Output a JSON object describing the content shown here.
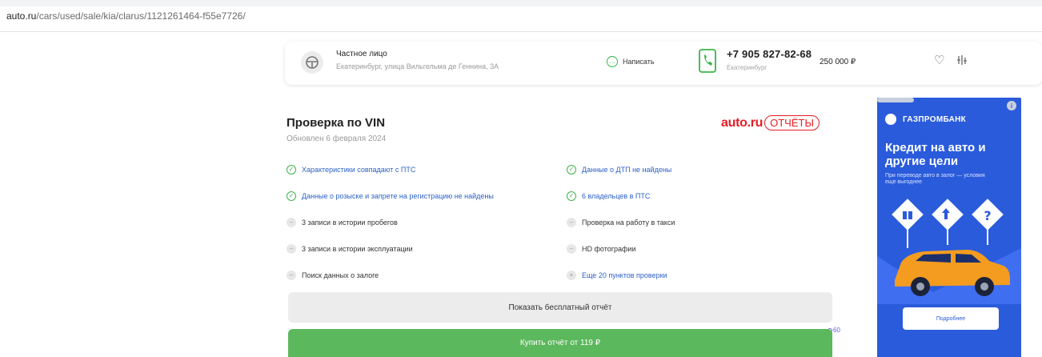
{
  "browser": {
    "url_domain": "auto.ru",
    "url_path": "/cars/used/sale/kia/clarus/1121261464-f55e7726/"
  },
  "seller": {
    "name": "Частное лицо",
    "address": "Екатеринбург, улица Вильгельма де Геннина, 3А",
    "write_label": "Написать",
    "phone": "+7 905 827-82-68",
    "phone_note": "Екатеринбург",
    "price": "250 000 ₽"
  },
  "vin_check": {
    "title": "Проверка по VIN",
    "updated": "Обновлен 6 февраля 2024",
    "brand_text": "auto.ru",
    "brand_pill": "ОТЧЁТЫ",
    "items_left": [
      {
        "text": "Характеристики совпадают с ПТС",
        "status": "ok"
      },
      {
        "text": "Данные о розыске и запрете на регистрацию не найдены",
        "status": "ok"
      },
      {
        "text": "3 записи в истории пробегов",
        "status": "neutral"
      },
      {
        "text": "3 записи в истории эксплуатации",
        "status": "neutral"
      },
      {
        "text": "Поиск данных о залоге",
        "status": "neutral"
      }
    ],
    "items_right": [
      {
        "text": "Данные о ДТП не найдены",
        "status": "ok"
      },
      {
        "text": "6 владельцев в ПТС",
        "status": "ok"
      },
      {
        "text": "Проверка на работу в такси",
        "status": "neutral"
      },
      {
        "text": "HD фотографии",
        "status": "neutral"
      },
      {
        "text": "Еще 20 пунктов проверки",
        "status": "link"
      }
    ],
    "free_button": "Показать бесплатный отчёт",
    "buy_button": "Купить отчёт от 119 ₽",
    "badge": "60"
  },
  "ad": {
    "info_icon": "i",
    "bank": "ГАЗПРОМБАНК",
    "headline": "Кредит на авто и другие цели",
    "subline": "При переводе авто в залог — условия еще выгоднее",
    "cta": "Подробнее",
    "car_color": "#f39c1f",
    "bg_color": "#2a5bdb"
  }
}
